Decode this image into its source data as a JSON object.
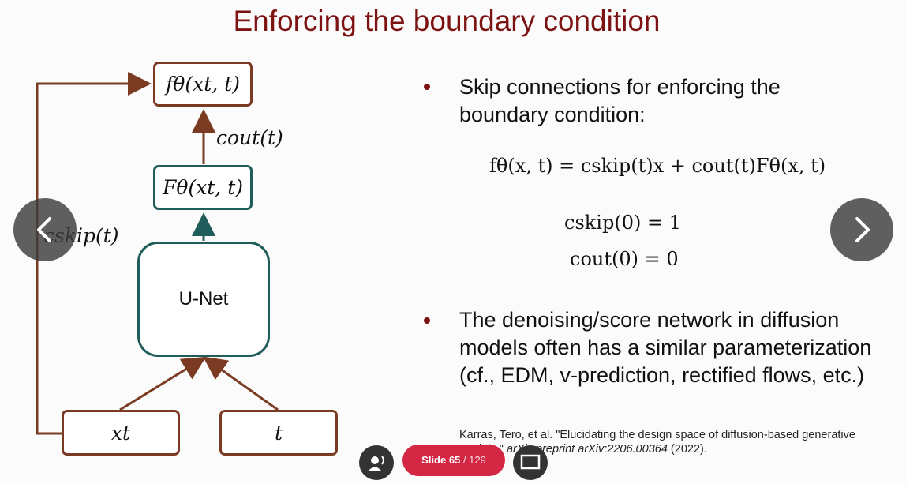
{
  "slide": {
    "title": "Enforcing the boundary condition"
  },
  "diagram": {
    "f_label": "fθ(xt, t)",
    "F_label": "Fθ(xt, t)",
    "cout_label": "cout(t)",
    "cskip_label": "cskip(t)",
    "unet_label": "U-Net",
    "xt_label": "xt",
    "t_label": "t"
  },
  "bullets": [
    "Skip connections for enforcing the boundary condition:",
    "The denoising/score network in diffusion models often has a similar parameterization (cf., EDM, v-prediction, rectified flows, etc.)"
  ],
  "equations": {
    "main": "fθ(x, t) = cskip(t)x + cout(t)Fθ(x, t)",
    "skip0": "cskip(0) = 1",
    "out0": "cout(0) = 0"
  },
  "citation": {
    "authors": "Karras, Tero, et al. \"Elucidating the design space of diffusion-based generative models.\"",
    "venue": "arXiv preprint arXiv:2206.00364",
    "year": "(2022)."
  },
  "player": {
    "slide_label": "Slide 65",
    "slide_total": "/ 129",
    "prev_icon": "chevron-left-icon",
    "next_icon": "chevron-right-icon",
    "audio_icon": "audio-icon",
    "fullscreen_icon": "screen-icon"
  },
  "colors": {
    "title": "#7d1212",
    "arrow_brown": "#7a3b22",
    "teal": "#1f5c5a",
    "pill": "#d42743"
  }
}
